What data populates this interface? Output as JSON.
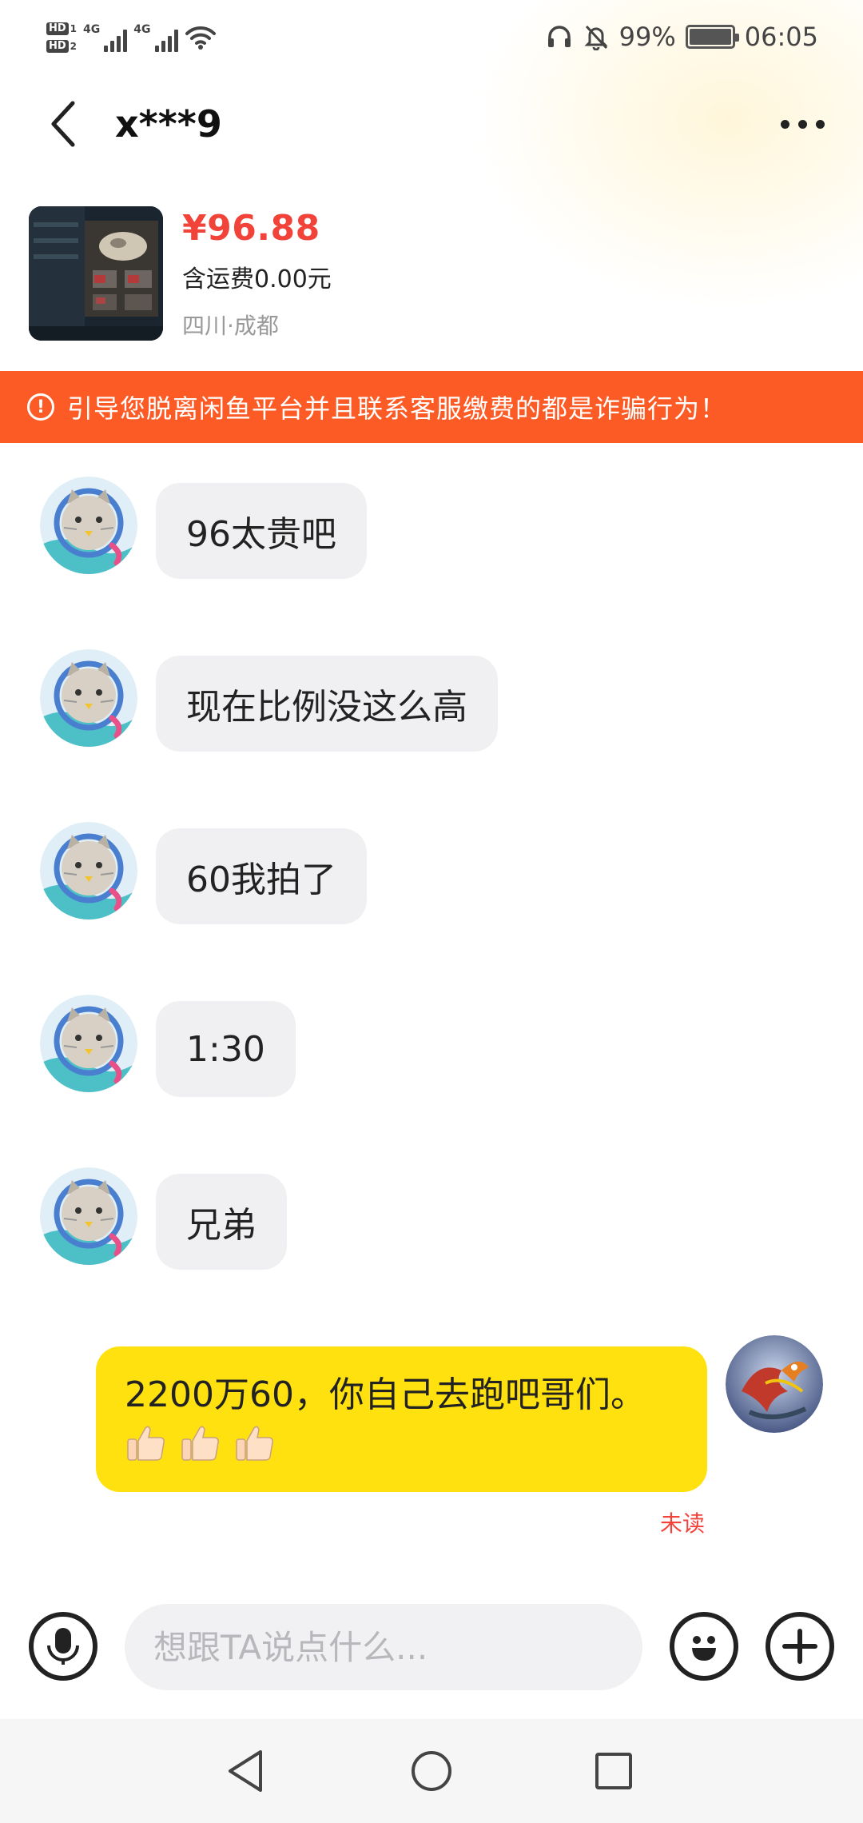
{
  "status_bar": {
    "hd1": "HD",
    "hd1_sim": "1",
    "hd2": "HD",
    "hd2_sim": "2",
    "network1": "4G",
    "network2": "4G",
    "battery_percent": "99%",
    "time": "06:05"
  },
  "header": {
    "title": "x***9"
  },
  "product": {
    "price": "¥96.88",
    "shipping": "含运费0.00元",
    "location": "四川·成都"
  },
  "warning": {
    "text": "引导您脱离闲鱼平台并且联系客服缴费的都是诈骗行为！"
  },
  "messages_incoming": [
    {
      "text": "96太贵吧"
    },
    {
      "text": "现在比例没这么高"
    },
    {
      "text": "60我拍了"
    },
    {
      "text": "1:30"
    },
    {
      "text": "兄弟"
    }
  ],
  "message_outgoing": {
    "text": "2200万60，你自己去跑吧哥们。",
    "emoji": [
      "thumbs-up",
      "thumbs-up",
      "thumbs-up"
    ],
    "read_status": "未读"
  },
  "input": {
    "placeholder": "想跟TA说点什么..."
  },
  "colors": {
    "accent_red": "#f2433a",
    "warning_bg": "#fd5b26",
    "outgoing_bubble": "#ffe10f",
    "incoming_bubble": "#f0f0f2"
  }
}
